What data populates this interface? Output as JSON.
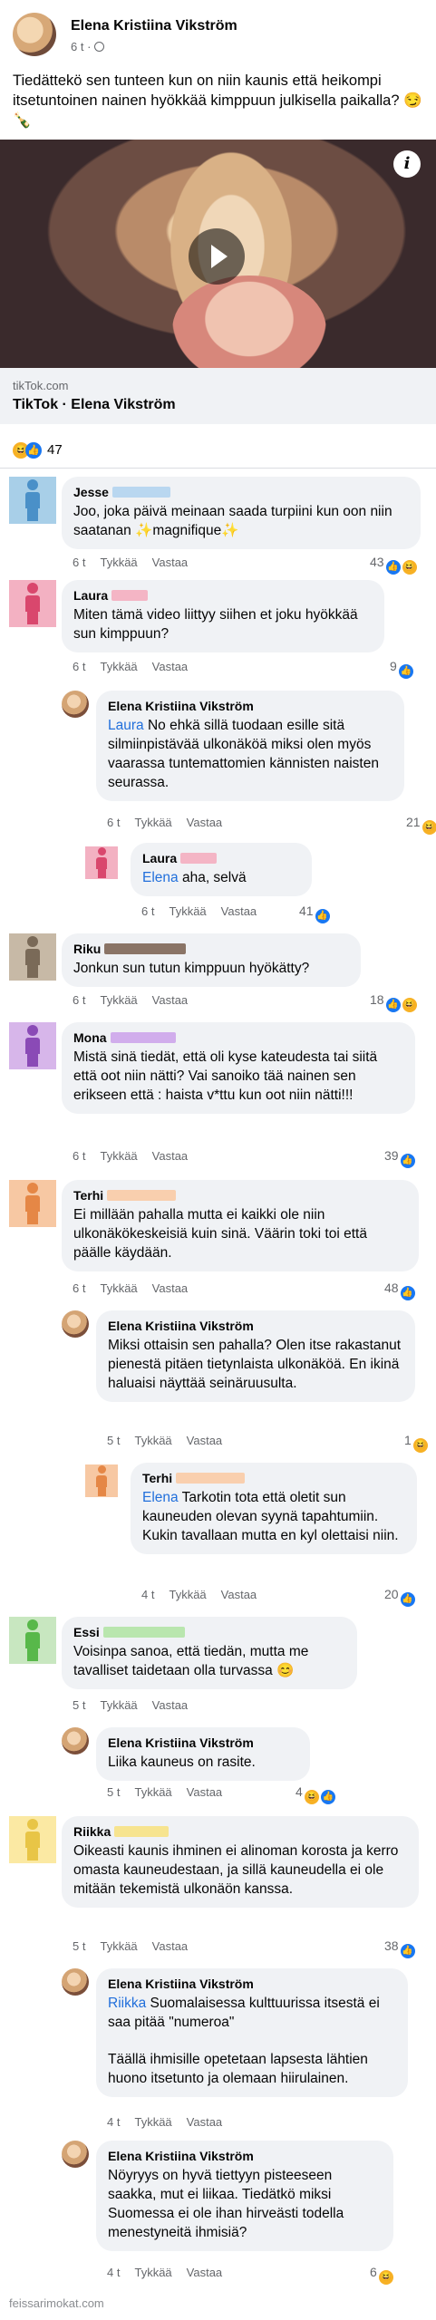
{
  "post": {
    "author": "Elena Kristiina Vikström",
    "time": "6 t",
    "audience_icon": "globe-icon",
    "text": "Tiedättekö sen tunteen kun on niin kaunis että heikompi itsetuntoinen nainen hyökkää kimppuun julkisella paikalla? 😏🍾",
    "link_domain": "tikTok.com",
    "link_title": "TikTok · Elena Vikström",
    "info_label": "i",
    "reactions_count": "47"
  },
  "comments": [
    {
      "name": "Jesse",
      "text": "Joo, joka päivä meinaan saada turpiini kun oon niin saatanan ✨magnifique✨",
      "time": "6 t",
      "like": "Tykkää",
      "reply": "Vastaa",
      "count": "43"
    },
    {
      "name": "Laura",
      "text": "Miten tämä video liittyy siihen et joku hyökkää sun kimppuun?",
      "time": "6 t",
      "like": "Tykkää",
      "reply": "Vastaa",
      "count": "9"
    },
    {
      "name": "Elena Kristiina Vikström",
      "mention": "Laura",
      "text": " No ehkä sillä tuodaan esille sitä silmiinpistävää ulkonäköä miksi olen myös vaarassa tuntemattomien kännisten naisten seurassa.",
      "time": "6 t",
      "like": "Tykkää",
      "reply": "Vastaa",
      "count": "21"
    },
    {
      "name": "Laura",
      "mention": "Elena",
      "text": " aha, selvä",
      "time": "6 t",
      "like": "Tykkää",
      "reply": "Vastaa",
      "count": "41"
    },
    {
      "name": "Riku",
      "text": "Jonkun sun tutun kimppuun hyökätty?",
      "time": "6 t",
      "like": "Tykkää",
      "reply": "Vastaa",
      "count": "18"
    },
    {
      "name": "Mona",
      "text": "Mistä sinä tiedät, että oli kyse kateudesta tai siitä että oot niin nätti? Vai sanoiko tää nainen sen erikseen että : haista v*ttu kun oot niin nätti!!!",
      "time": "6 t",
      "like": "Tykkää",
      "reply": "Vastaa",
      "count": "39"
    },
    {
      "name": "Terhi",
      "text": "Ei millään pahalla mutta ei kaikki ole niin ulkonäkökeskeisiä kuin sinä. Väärin toki toi että päälle käydään.",
      "time": "6 t",
      "like": "Tykkää",
      "reply": "Vastaa",
      "count": "48"
    },
    {
      "name": "Elena Kristiina Vikström",
      "text": "Miksi ottaisin sen pahalla? Olen itse rakastanut pienestä pitäen tietynlaista ulkonäköä. En ikinä haluaisi näyttää seinäruusulta.",
      "time": "5 t",
      "like": "Tykkää",
      "reply": "Vastaa",
      "count": "1"
    },
    {
      "name": "Terhi",
      "mention": "Elena",
      "text": " Tarkotin tota että oletit sun kauneuden olevan syynä tapahtumiin. Kukin tavallaan mutta en kyl olettaisi niin.",
      "time": "4 t",
      "like": "Tykkää",
      "reply": "Vastaa",
      "count": "20"
    },
    {
      "name": "Essi",
      "text": "Voisinpa sanoa, että tiedän, mutta me tavalliset taidetaan olla turvassa 😊",
      "time": "5 t",
      "like": "Tykkää",
      "reply": "Vastaa",
      "count": ""
    },
    {
      "name": "Elena Kristiina Vikström",
      "text": "Liika kauneus on rasite.",
      "time": "5 t",
      "like": "Tykkää",
      "reply": "Vastaa",
      "count": "4"
    },
    {
      "name": "Riikka",
      "text": "Oikeasti kaunis ihminen ei alinoman korosta ja kerro omasta kauneudestaan, ja sillä kauneudella ei ole mitään tekemistä ulkonäön kanssa.",
      "time": "5 t",
      "like": "Tykkää",
      "reply": "Vastaa",
      "count": "38"
    },
    {
      "name": "Elena Kristiina Vikström",
      "mention": "Riikka",
      "text": " Suomalaisessa kulttuurissa itsestä ei saa pitää \"numeroa\"",
      "text2": "Täällä ihmisille opetetaan lapsesta lähtien huono itsetunto ja olemaan hiirulainen.",
      "time": "4 t",
      "like": "Tykkää",
      "reply": "Vastaa",
      "count": ""
    },
    {
      "name": "Elena Kristiina Vikström",
      "text": "Nöyryys on hyvä tiettyyn pisteeseen saakka, mut ei liikaa. Tiedätkö miksi Suomessa ei ole ihan hirveästi todella menestyneitä ihmisiä?",
      "time": "4 t",
      "like": "Tykkää",
      "reply": "Vastaa",
      "count": "6"
    }
  ],
  "footer": "feissarimokat.com",
  "colors": {
    "accent": "#1877f2",
    "mention": "#216fdb",
    "bubble": "#f0f2f5",
    "meta": "#65676b"
  }
}
